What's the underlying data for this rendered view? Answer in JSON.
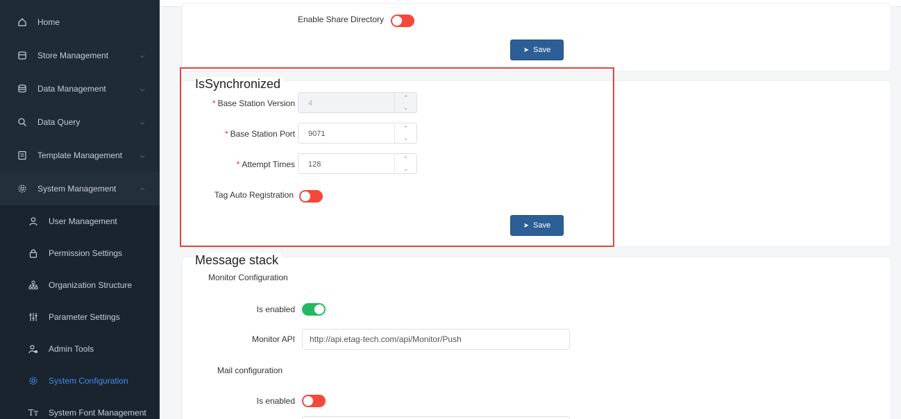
{
  "sidebar": {
    "items": [
      {
        "label": "Home",
        "icon": "home-icon"
      },
      {
        "label": "Store Management",
        "icon": "store-icon"
      },
      {
        "label": "Data Management",
        "icon": "database-icon"
      },
      {
        "label": "Data Query",
        "icon": "search-icon"
      },
      {
        "label": "Template Management",
        "icon": "template-icon"
      },
      {
        "label": "System Management",
        "icon": "gear-icon"
      }
    ],
    "sub_items": [
      {
        "label": "User Management",
        "icon": "user-icon"
      },
      {
        "label": "Permission Settings",
        "icon": "lock-icon"
      },
      {
        "label": "Organization Structure",
        "icon": "org-icon"
      },
      {
        "label": "Parameter Settings",
        "icon": "sliders-icon"
      },
      {
        "label": "Admin Tools",
        "icon": "admin-icon"
      },
      {
        "label": "System Configuration",
        "icon": "config-icon"
      },
      {
        "label": "System Font Management",
        "icon": "font-icon"
      }
    ],
    "active_item": "System Configuration",
    "active_color": "#3d8cf2"
  },
  "share_card": {
    "enable_share_label": "Enable Share Directory",
    "enable_share_state": "off",
    "save_label": "Save"
  },
  "sync_card": {
    "title": "IsSynchronized",
    "base_station_version_label": "Base Station Version",
    "base_station_version_value": "4",
    "base_station_port_label": "Base Station Port",
    "base_station_port_value": "9071",
    "attempt_times_label": "Attempt Times",
    "attempt_times_value": "128",
    "tag_auto_registration_label": "Tag Auto Registration",
    "tag_auto_registration_state": "off",
    "save_label": "Save",
    "required_mark": "*"
  },
  "message_card": {
    "title": "Message stack",
    "monitor_section": "Monitor Configuration",
    "monitor_enabled_label": "Is enabled",
    "monitor_enabled_state": "on",
    "monitor_api_label": "Monitor API",
    "monitor_api_value": "http://api.etag-tech.com/api/Monitor/Push",
    "mail_section": "Mail configuration",
    "mail_enabled_label": "Is enabled",
    "mail_enabled_state": "off"
  },
  "colors": {
    "sidebar_bg": "#1f2b36",
    "toggle_off": "#f5483a",
    "toggle_on": "#25b864",
    "save_button": "#2c5f96",
    "highlight_border": "#e0453a"
  }
}
